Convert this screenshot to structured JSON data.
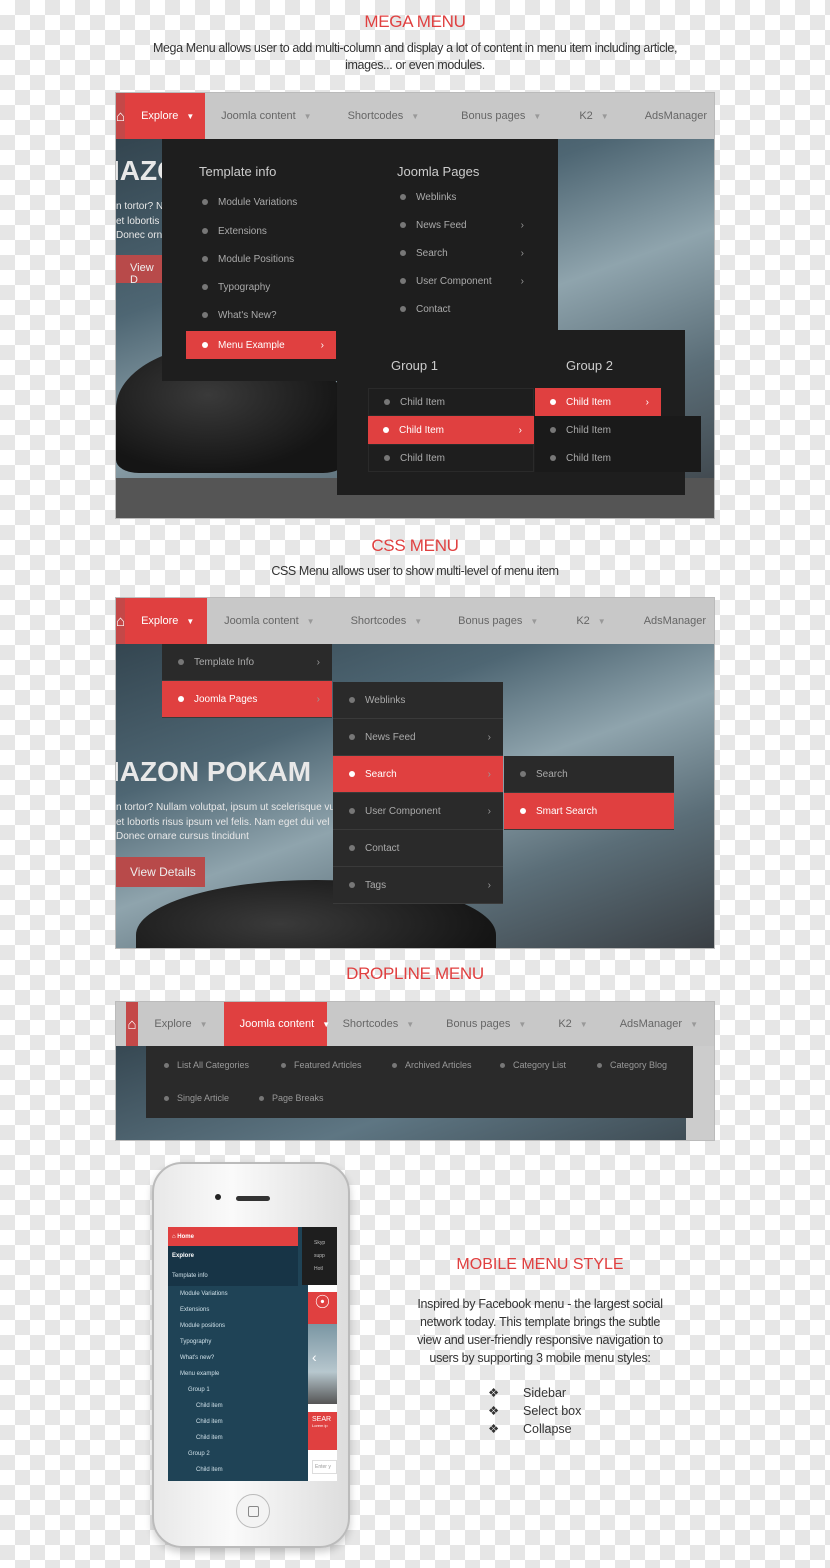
{
  "mega": {
    "title": "MEGA MENU",
    "desc1": "Mega Menu allows user to add multi-column and display a lot of content in menu item including article,",
    "desc2": "images... or  even modules.",
    "nav": [
      "Explore",
      "Joomla content",
      "Shortcodes",
      "Bonus pages",
      "K2",
      "AdsManager"
    ],
    "hero": {
      "title": "IAZO",
      "l1": "n tortor? N",
      "l2": "et lobortis",
      "l3": "Donec orna",
      "btn": "View D"
    },
    "col1": {
      "heading": "Template info",
      "items": [
        "Module Variations",
        "Extensions",
        "Module Positions",
        "Typography",
        "What's New?",
        "Menu Example"
      ]
    },
    "col2": {
      "heading": "Joomla Pages",
      "items": [
        "Weblinks",
        "News Feed",
        "Search",
        "User Component",
        "Contact"
      ]
    },
    "group1": {
      "heading": "Group 1",
      "items": [
        "Child Item",
        "Child Item",
        "Child Item"
      ]
    },
    "group2": {
      "heading": "Group 2",
      "items": [
        "Child Item",
        "Child Item",
        "Child Item"
      ]
    }
  },
  "css": {
    "title": "CSS MENU",
    "desc": "CSS Menu allows user to show multi-level of menu item",
    "nav": [
      "Explore",
      "Joomla content",
      "Shortcodes",
      "Bonus pages",
      "K2",
      "AdsManager"
    ],
    "hero": {
      "title": "IAZON POKAM",
      "l1": "n tortor? Nullam volutpat, ipsum ut scelerisque vu",
      "l2": "et lobortis risus ipsum vel felis. Nam eget dui vel",
      "l3": "Donec ornare cursus tincidunt",
      "btn": "View Details"
    },
    "level1": [
      "Template Info",
      "Joomla Pages"
    ],
    "level2": [
      "Weblinks",
      "News Feed",
      "Search",
      "User Component",
      "Contact",
      "Tags"
    ],
    "level3": [
      "Search",
      "Smart Search"
    ]
  },
  "dropline": {
    "title": "DROPLINE MENU",
    "nav": [
      "Explore",
      "Joomla content",
      "Shortcodes",
      "Bonus pages",
      "K2",
      "AdsManager"
    ],
    "items": [
      "List All Categories",
      "Featured Articles",
      "Archived Articles",
      "Category List",
      "Category Blog",
      "Single Article",
      "Page Breaks"
    ]
  },
  "mobile": {
    "title": "MOBILE MENU STYLE",
    "p1": "Inspired by Facebook menu - the largest social",
    "p2": "network today. This template brings the subtle",
    "p3": "view and user-friendly responsive navigation to",
    "p4": "users by supporting 3 mobile menu styles:",
    "styles": [
      "Sidebar",
      "Select box",
      "Collapse"
    ],
    "phone": {
      "home": "Home",
      "explore": "Explore",
      "template": "Template info",
      "items": [
        "Module Variations",
        "Extensions",
        "Module positions",
        "Typography",
        "What's new?",
        "Menu example"
      ],
      "group1": "Group 1",
      "group2": "Group 2",
      "child": "Child item",
      "side": [
        "Skyp",
        "supp",
        "Hotl"
      ],
      "search": "SEAR",
      "lorem": "Lorem ip",
      "enter": "Enter y"
    }
  },
  "colors": {
    "accent": "#e04040",
    "dark": "#1e1e1e",
    "nav": "#c8c8c8",
    "mobile_bg": "#1f4356"
  }
}
